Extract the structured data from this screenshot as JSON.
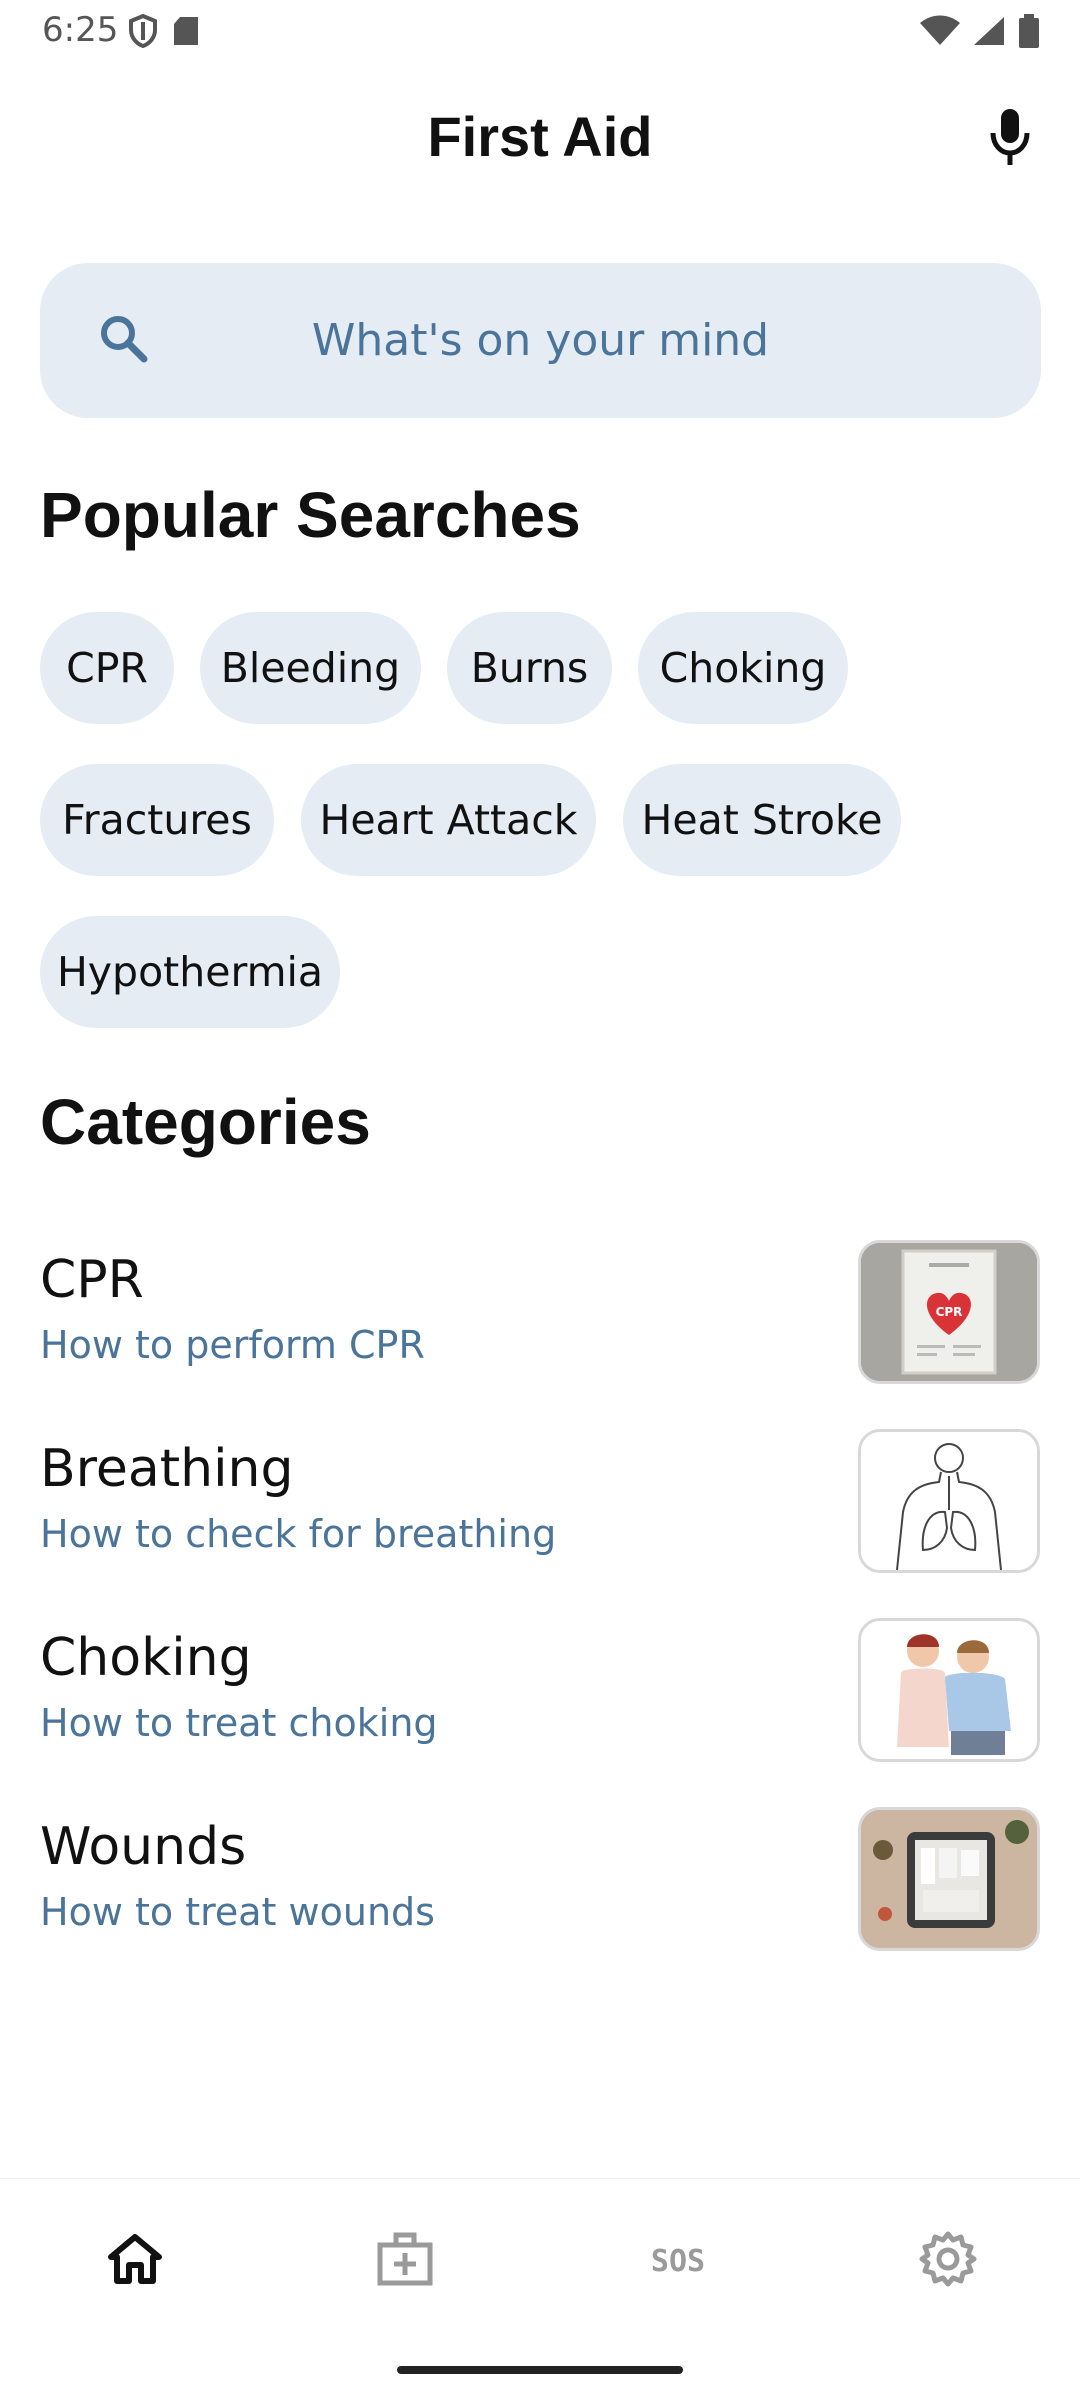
{
  "status_bar": {
    "time": "6:25"
  },
  "app_bar": {
    "title": "First Aid",
    "mic_icon": "microphone-icon"
  },
  "search": {
    "placeholder": "What's on your mind",
    "icon": "search-icon"
  },
  "popular": {
    "title": "Popular Searches",
    "chips": [
      "CPR",
      "Bleeding",
      "Burns",
      "Choking",
      "Fractures",
      "Heart Attack",
      "Heat Stroke",
      "Hypothermia"
    ]
  },
  "categories": {
    "title": "Categories",
    "items": [
      {
        "title": "CPR",
        "subtitle": "How to perform CPR",
        "thumb_text": "CPR"
      },
      {
        "title": "Breathing",
        "subtitle": "How to check for breathing"
      },
      {
        "title": "Choking",
        "subtitle": "How to treat choking"
      },
      {
        "title": "Wounds",
        "subtitle": "How to treat wounds"
      }
    ]
  },
  "bottom_nav": {
    "items": [
      {
        "icon": "home-icon",
        "active": true
      },
      {
        "icon": "first-aid-kit-icon",
        "active": false
      },
      {
        "icon": "sos-icon",
        "label": "SOS",
        "active": false
      },
      {
        "icon": "settings-icon",
        "active": false
      }
    ]
  },
  "colors": {
    "accent_text": "#4a7499",
    "chip_bg": "#e6ecf4",
    "inactive_icon": "#9a9a9a"
  }
}
